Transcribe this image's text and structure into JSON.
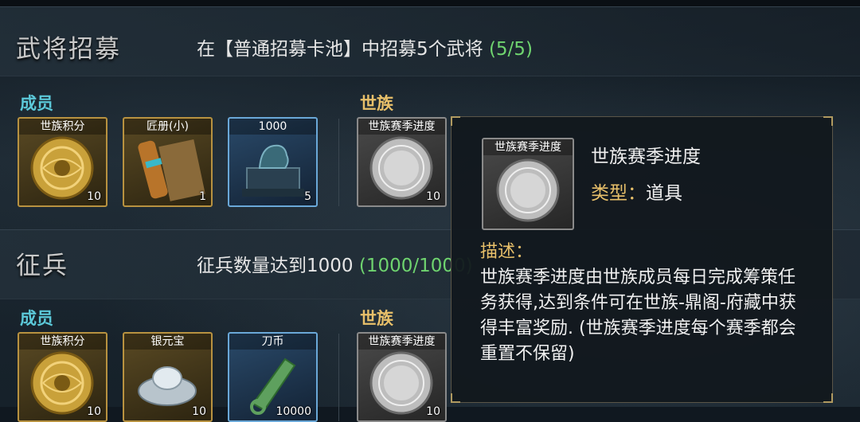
{
  "sections": [
    {
      "title": "武将招募",
      "desc": "在【普通招募卡池】中招募5个武将",
      "progress": "(5/5)",
      "member_label": "成员",
      "clan_label": "世族",
      "member_items": [
        {
          "name": "世族积分",
          "count": "10",
          "icon": "clan-points-coin-icon"
        },
        {
          "name": "匠册(小)",
          "count": "1",
          "icon": "scroll-icon"
        },
        {
          "name": "1000",
          "count": "5",
          "icon": "bronze-qilin-icon"
        }
      ],
      "clan_items": [
        {
          "name": "世族赛季进度",
          "count": "10",
          "icon": "season-progress-coin-icon"
        }
      ]
    },
    {
      "title": "征兵",
      "desc": "征兵数量达到1000",
      "progress": "(1000/1000)",
      "member_label": "成员",
      "clan_label": "世族",
      "member_items": [
        {
          "name": "世族积分",
          "count": "10",
          "icon": "clan-points-coin-icon"
        },
        {
          "name": "银元宝",
          "count": "10",
          "icon": "silver-ingot-icon"
        },
        {
          "name": "刀币",
          "count": "10000",
          "icon": "knife-coin-icon"
        }
      ],
      "clan_items": [
        {
          "name": "世族赛季进度",
          "count": "10",
          "icon": "season-progress-coin-icon"
        }
      ]
    }
  ],
  "tooltip": {
    "icon_name": "世族赛季进度",
    "title": "世族赛季进度",
    "type_key": "类型：",
    "type_value": "道具",
    "desc_label": "描述：",
    "desc": "世族赛季进度由世族成员每日完成筹策任务获得,达到条件可在世族-鼎阁-府藏中获得丰富奖励. (世族赛季进度每个赛季都会重置不保留)"
  },
  "colors": {
    "member_label": "#5cc9d9",
    "clan_label": "#e8c06a",
    "progress": "#6fd46f"
  }
}
